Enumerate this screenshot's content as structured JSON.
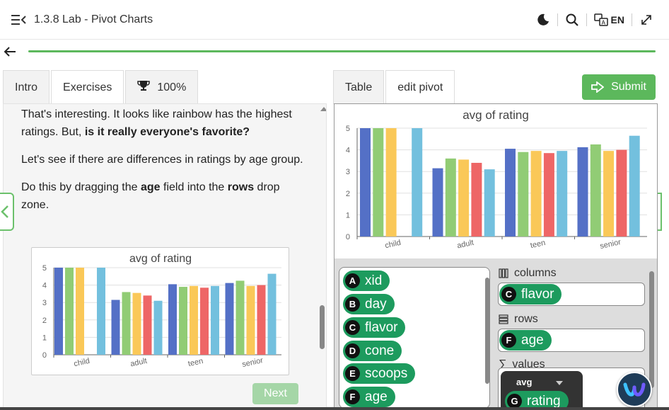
{
  "header": {
    "title": "1.3.8 Lab - Pivot Charts",
    "language": "EN",
    "icons": [
      "menu-collapse-icon",
      "moon-icon",
      "search-icon",
      "translate-icon",
      "expand-icon"
    ]
  },
  "progress": {
    "fraction": 1.0,
    "color": "#5cb85c"
  },
  "left_tabs": [
    {
      "label": "Intro",
      "active": false
    },
    {
      "label": "Exercises",
      "active": true
    },
    {
      "label": "100%",
      "icon": "trophy-icon",
      "active": false
    }
  ],
  "lesson": {
    "p1_a": "That's interesting. It looks like rainbow has the highest ratings. But, ",
    "p1_b": "is it really everyone's favorite?",
    "p2": "Let's see if there are differences in ratings by age group.",
    "p3_a": "Do this by dragging the ",
    "p3_b": "age",
    "p3_c": " field into the ",
    "p3_d": "rows",
    "p3_e": " drop zone."
  },
  "next_label": "Next",
  "right_tabs": [
    {
      "label": "Table",
      "active": false
    },
    {
      "label": "edit pivot",
      "active": true
    }
  ],
  "submit_label": "Submit",
  "fields": [
    {
      "letter": "A",
      "name": "xid"
    },
    {
      "letter": "B",
      "name": "day"
    },
    {
      "letter": "C",
      "name": "flavor"
    },
    {
      "letter": "D",
      "name": "cone"
    },
    {
      "letter": "E",
      "name": "scoops"
    },
    {
      "letter": "F",
      "name": "age"
    }
  ],
  "zones": {
    "columns_label": "columns",
    "columns_chip": {
      "letter": "C",
      "name": "flavor"
    },
    "rows_label": "rows",
    "rows_chip": {
      "letter": "F",
      "name": "age"
    },
    "values_label": "values",
    "agg_label": "avg",
    "values_chip": {
      "letter": "G",
      "name": "rating"
    }
  },
  "colors": {
    "accent": "#5cb85c",
    "chip": "#1d9b5e",
    "series": [
      "#5470c6",
      "#91cc75",
      "#fac858",
      "#ee6666",
      "#73c0de"
    ]
  },
  "chart_data": {
    "type": "bar",
    "title": "avg of rating",
    "categories": [
      "child",
      "adult",
      "teen",
      "senior"
    ],
    "series": [
      {
        "values": [
          5.0,
          3.15,
          4.05,
          4.12
        ]
      },
      {
        "values": [
          5.0,
          3.6,
          3.9,
          4.25
        ]
      },
      {
        "values": [
          5.0,
          3.55,
          3.95,
          3.95
        ]
      },
      {
        "values": [
          null,
          3.4,
          3.85,
          4.0
        ]
      },
      {
        "values": [
          5.0,
          3.1,
          3.95,
          4.65
        ]
      }
    ],
    "ylim": [
      0,
      5
    ],
    "yticks": [
      0,
      1,
      2,
      3,
      4,
      5
    ],
    "grid": true
  }
}
